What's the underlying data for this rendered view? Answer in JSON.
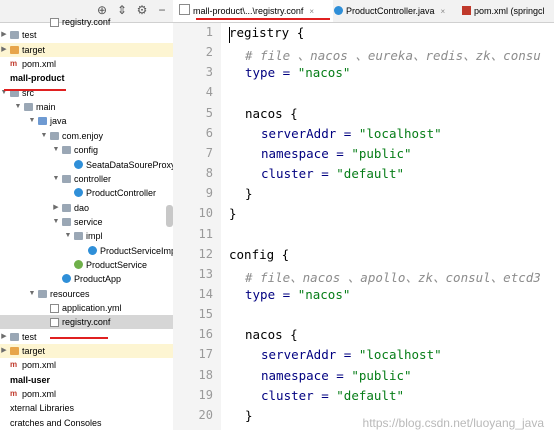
{
  "project_tree": {
    "rows": [
      {
        "label": "registry.conf",
        "icon": "config-file-icon",
        "indent": 3,
        "arrow": ""
      },
      {
        "label": "test",
        "icon": "folder-icon",
        "indent": 0,
        "arrow": "right"
      },
      {
        "label": "target",
        "icon": "orange-folder-icon",
        "indent": 0,
        "arrow": "right"
      },
      {
        "label": "pom.xml",
        "icon": "maven-file-icon",
        "indent": 0,
        "arrow": ""
      },
      {
        "label": "mall-product",
        "icon": "",
        "indent": 0,
        "arrow": "",
        "bold": true
      },
      {
        "label": "src",
        "icon": "folder-icon",
        "indent": 0,
        "arrow": "down"
      },
      {
        "label": "main",
        "icon": "folder-icon",
        "indent": 1,
        "arrow": "down"
      },
      {
        "label": "java",
        "icon": "blue-folder-icon",
        "indent": 2,
        "arrow": "down"
      },
      {
        "label": "com.enjoy",
        "icon": "package-icon",
        "indent": 3,
        "arrow": "down"
      },
      {
        "label": "config",
        "icon": "package-icon",
        "indent": 4,
        "arrow": "down"
      },
      {
        "label": "SeataDataSoureProxy",
        "icon": "class-icon",
        "indent": 5,
        "arrow": ""
      },
      {
        "label": "controller",
        "icon": "package-icon",
        "indent": 4,
        "arrow": "down"
      },
      {
        "label": "ProductController",
        "icon": "class-icon",
        "indent": 5,
        "arrow": ""
      },
      {
        "label": "dao",
        "icon": "package-icon",
        "indent": 4,
        "arrow": "right"
      },
      {
        "label": "service",
        "icon": "package-icon",
        "indent": 4,
        "arrow": "down"
      },
      {
        "label": "impl",
        "icon": "package-icon",
        "indent": 5,
        "arrow": "down"
      },
      {
        "label": "ProductServiceImp",
        "icon": "class-icon",
        "indent": 6,
        "arrow": ""
      },
      {
        "label": "ProductService",
        "icon": "interface-icon",
        "indent": 5,
        "arrow": ""
      },
      {
        "label": "ProductApp",
        "icon": "class-icon",
        "indent": 4,
        "arrow": ""
      },
      {
        "label": "resources",
        "icon": "folder-icon",
        "indent": 2,
        "arrow": "down"
      },
      {
        "label": "application.yml",
        "icon": "yaml-file-icon",
        "indent": 3,
        "arrow": ""
      },
      {
        "label": "registry.conf",
        "icon": "config-file-icon",
        "indent": 3,
        "arrow": "",
        "selected": true
      },
      {
        "label": "test",
        "icon": "folder-icon",
        "indent": 0,
        "arrow": "right"
      },
      {
        "label": "target",
        "icon": "orange-folder-icon",
        "indent": 0,
        "arrow": "right"
      },
      {
        "label": "pom.xml",
        "icon": "maven-file-icon",
        "indent": 0,
        "arrow": ""
      },
      {
        "label": "mall-user",
        "icon": "",
        "indent": 0,
        "arrow": "",
        "bold": true
      },
      {
        "label": "pom.xml",
        "icon": "maven-file-icon",
        "indent": 0,
        "arrow": ""
      },
      {
        "label": "xternal Libraries",
        "icon": "",
        "indent": 0,
        "arrow": ""
      },
      {
        "label": "cratches and Consoles",
        "icon": "",
        "indent": 0,
        "arrow": ""
      }
    ]
  },
  "toolbar": {
    "icons": [
      "locate-icon",
      "collapse-icon",
      "settings-icon",
      "hide-icon"
    ]
  },
  "tabs": [
    {
      "label": "mall-product\\...\\registry.conf",
      "icon": "config-file-icon",
      "active": true,
      "close": "×"
    },
    {
      "label": "ProductController.java",
      "icon": "class-icon",
      "active": false,
      "close": "×"
    },
    {
      "label": "pom.xml (springcl",
      "icon": "maven-file-icon",
      "active": false,
      "close": ""
    }
  ],
  "editor": {
    "line_numbers": [
      "1",
      "2",
      "3",
      "4",
      "5",
      "6",
      "7",
      "8",
      "9",
      "10",
      "11",
      "12",
      "13",
      "14",
      "15",
      "16",
      "17",
      "18",
      "19",
      "20"
    ],
    "lines": [
      {
        "indent": 0,
        "tokens": [
          {
            "t": "registry {",
            "c": "o"
          }
        ]
      },
      {
        "indent": 1,
        "tokens": [
          {
            "t": "# file 、nacos 、eureka、redis、zk、consu",
            "c": "c"
          }
        ]
      },
      {
        "indent": 1,
        "tokens": [
          {
            "t": "type = ",
            "c": "k"
          },
          {
            "t": "\"nacos\"",
            "c": "s"
          }
        ]
      },
      {
        "indent": 0,
        "tokens": []
      },
      {
        "indent": 1,
        "tokens": [
          {
            "t": "nacos {",
            "c": "o"
          }
        ]
      },
      {
        "indent": 2,
        "tokens": [
          {
            "t": "serverAddr = ",
            "c": "k"
          },
          {
            "t": "\"localhost\"",
            "c": "s"
          }
        ]
      },
      {
        "indent": 2,
        "tokens": [
          {
            "t": "namespace = ",
            "c": "k"
          },
          {
            "t": "\"public\"",
            "c": "s"
          }
        ]
      },
      {
        "indent": 2,
        "tokens": [
          {
            "t": "cluster = ",
            "c": "k"
          },
          {
            "t": "\"default\"",
            "c": "s"
          }
        ]
      },
      {
        "indent": 1,
        "tokens": [
          {
            "t": "}",
            "c": "o"
          }
        ]
      },
      {
        "indent": 0,
        "tokens": [
          {
            "t": "}",
            "c": "o"
          }
        ]
      },
      {
        "indent": 0,
        "tokens": []
      },
      {
        "indent": 0,
        "tokens": [
          {
            "t": "config {",
            "c": "o"
          }
        ]
      },
      {
        "indent": 1,
        "tokens": [
          {
            "t": "# file、nacos 、apollo、zk、consul、etcd3",
            "c": "c"
          }
        ]
      },
      {
        "indent": 1,
        "tokens": [
          {
            "t": "type = ",
            "c": "k"
          },
          {
            "t": "\"nacos\"",
            "c": "s"
          }
        ]
      },
      {
        "indent": 0,
        "tokens": []
      },
      {
        "indent": 1,
        "tokens": [
          {
            "t": "nacos {",
            "c": "o"
          }
        ]
      },
      {
        "indent": 2,
        "tokens": [
          {
            "t": "serverAddr = ",
            "c": "k"
          },
          {
            "t": "\"localhost\"",
            "c": "s"
          }
        ]
      },
      {
        "indent": 2,
        "tokens": [
          {
            "t": "namespace = ",
            "c": "k"
          },
          {
            "t": "\"public\"",
            "c": "s"
          }
        ]
      },
      {
        "indent": 2,
        "tokens": [
          {
            "t": "cluster = ",
            "c": "k"
          },
          {
            "t": "\"default\"",
            "c": "s"
          }
        ]
      },
      {
        "indent": 1,
        "tokens": [
          {
            "t": "}",
            "c": "o"
          }
        ]
      }
    ]
  },
  "watermark": "https://blog.csdn.net/luoyang_java",
  "colors": {
    "annotation_red": "#e02020",
    "selection": "#d6d6d6"
  }
}
